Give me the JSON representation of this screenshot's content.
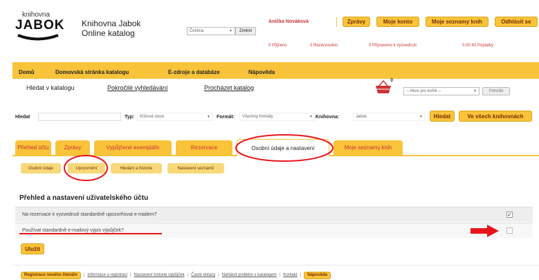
{
  "logo": {
    "line1": "knihovna",
    "line2": "JABOK"
  },
  "header": {
    "title_line1": "Knihovna Jabok",
    "title_line2": "Online katalog",
    "language": "Čeština",
    "change_button": "Změnit"
  },
  "user": {
    "name": "Anička Nováková",
    "buttons": [
      "Zprávy",
      "Moje konto",
      "Moje seznamy knih",
      "Odhlásit se"
    ]
  },
  "status_links": [
    "0 Půjčeno",
    "0 Rezervováno",
    "0 Připraveno k vyzvednutí",
    "0,00 Kč Poplatky"
  ],
  "nav": [
    "Domů",
    "Domovská stránka katalogu",
    "E-zdroje a databáze",
    "Nápověda"
  ],
  "search_links": [
    "Hledat v katalogu",
    "Pokročilé vyhledávání",
    "Procházet katalog"
  ],
  "cart": {
    "badge": "0",
    "action_placeholder": "-- Akce pro košík --",
    "go_button": "Potvrdit"
  },
  "search_bar": {
    "hledat_label": "Hledat",
    "typ_label": "Typ:",
    "typ_value": "Klíčové slovo",
    "format_label": "Formát:",
    "format_value": "Všechny formáty",
    "library_label": "Knihovna:",
    "library_value": "Jabok",
    "search_button": "Hledat",
    "all_libraries_button": "Ve všech knihovnách"
  },
  "account_tabs": [
    "Přehled účtu",
    "Zprávy",
    "Vypůjčené exempláře",
    "Rezervace",
    "Osobní údaje a nastavení",
    "Moje seznamy knih"
  ],
  "sub_tabs": [
    "Osobní údaje",
    "Upozornění",
    "Hledání a historie",
    "Nastavení seznamů"
  ],
  "section_title": "Přehled a nastavení uživatelského účtu",
  "settings": [
    {
      "label": "Na rezervace k vyzvednutí standardně upozorňovat e-mailem?",
      "checked": true
    },
    {
      "label": "Používat standardně e-mailový výpis výpůjček?",
      "checked": false
    }
  ],
  "save_button": "Uložit",
  "footer": {
    "register_button": "Registrace nového čtenáře",
    "links": [
      "Informace o registraci",
      "Nastavení historie výpůjček",
      "Časté dotazy",
      "Nahlásit problém s katalogem",
      "Kontakt"
    ],
    "help_button": "Nápověda"
  },
  "colors": {
    "accent": "#f9c33a",
    "annotation_red": "#e8141c"
  }
}
